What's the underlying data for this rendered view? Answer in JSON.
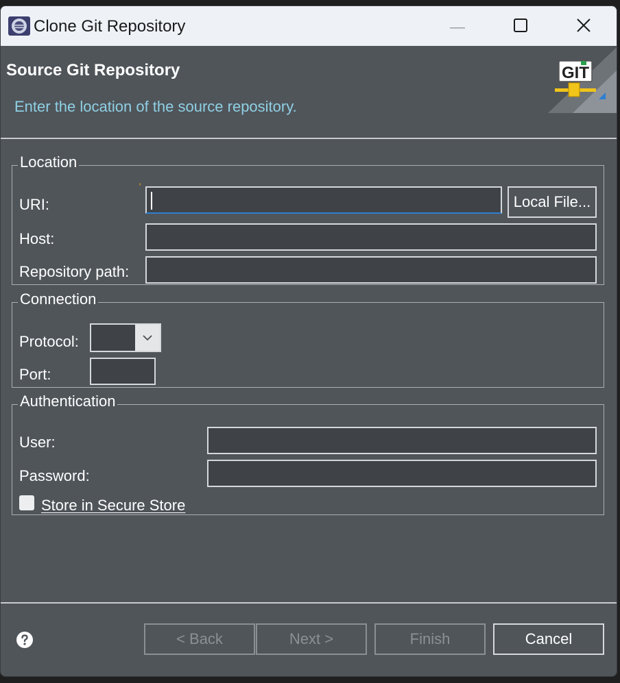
{
  "window": {
    "title": "Clone Git Repository"
  },
  "header": {
    "title": "Source Git Repository",
    "description": "Enter the location of the source repository.",
    "banner_text": "GIT"
  },
  "location": {
    "legend": "Location",
    "uri_label": "URI:",
    "uri_value": "",
    "required_mark": "'",
    "local_file_label": "Local File...",
    "host_label": "Host:",
    "host_value": "",
    "repo_path_label": "Repository path:",
    "repo_path_value": ""
  },
  "connection": {
    "legend": "Connection",
    "protocol_label": "Protocol:",
    "protocol_value": "",
    "port_label": "Port:",
    "port_value": ""
  },
  "authentication": {
    "legend": "Authentication",
    "user_label": "User:",
    "user_value": "",
    "password_label": "Password:",
    "password_value": "",
    "store_label": "Store in Secure Store",
    "store_checked": false
  },
  "buttons": {
    "back": "< Back",
    "next": "Next >",
    "finish": "Finish",
    "cancel": "Cancel"
  },
  "colors": {
    "dialog_bg": "#50555a",
    "titlebar_bg": "#eef2f7",
    "description_text": "#8fd0e4",
    "field_bg": "#3f4347",
    "focus_accent": "#2d7fd2",
    "required_mark": "#f2a100"
  },
  "icons": [
    "eclipse-app-icon",
    "minimize-icon",
    "maximize-icon",
    "close-icon",
    "git-banner-icon",
    "chevron-down-icon",
    "help-icon"
  ]
}
